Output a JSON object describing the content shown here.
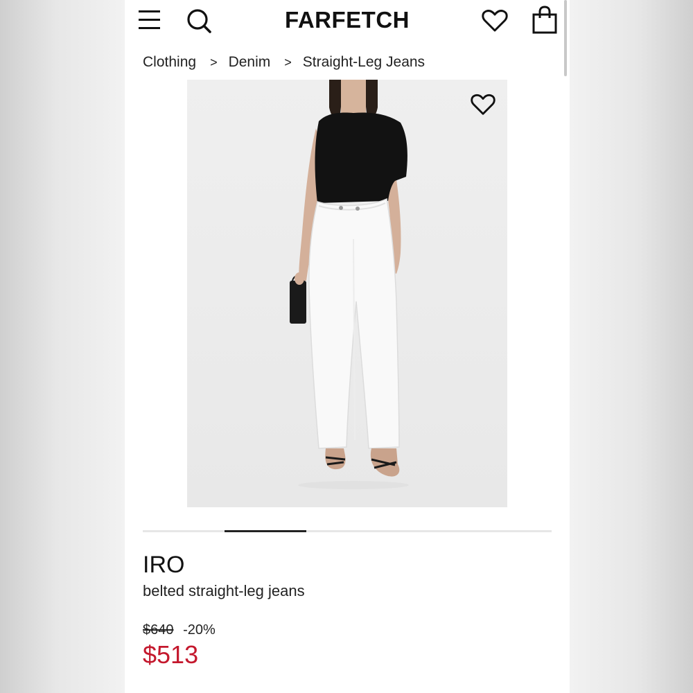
{
  "header": {
    "logo": "FARFETCH",
    "icons": [
      "menu-icon",
      "search-icon",
      "heart-icon",
      "shopping-bag-icon"
    ]
  },
  "breadcrumb": {
    "items": [
      "Clothing",
      "Denim",
      "Straight-Leg Jeans"
    ],
    "separator": ">"
  },
  "product": {
    "image_alt": "Model wearing black asymmetric top and white belted straight-leg jeans, holding a black handbag",
    "carousel": {
      "active_index": 1,
      "total": 5
    },
    "brand": "IRO",
    "name": "belted straight-leg jeans",
    "original_price": "$640",
    "discount": "-20%",
    "sale_price": "$513"
  },
  "colors": {
    "sale_price": "#c4182d",
    "text": "#222222",
    "accent": "#111111"
  }
}
